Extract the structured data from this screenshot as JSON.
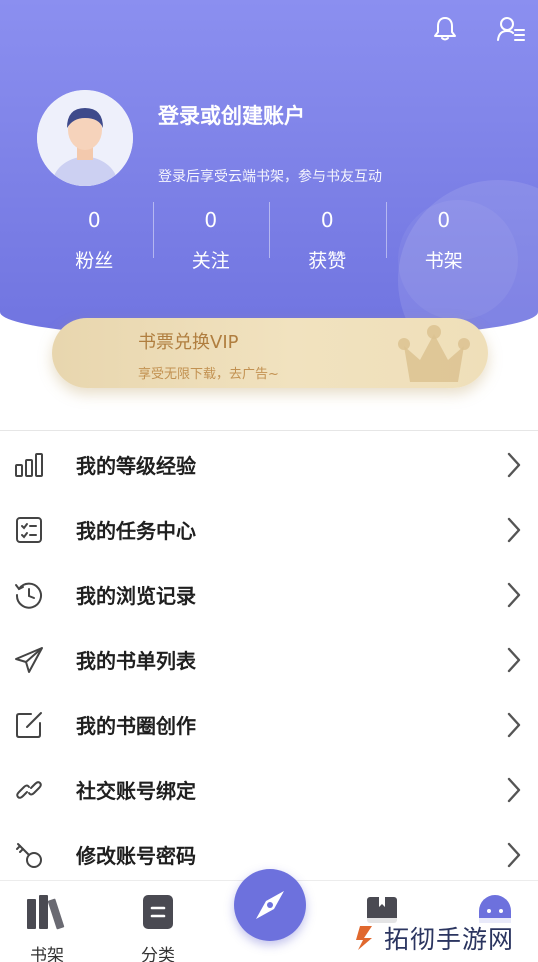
{
  "header": {
    "notification_icon": "bell-icon",
    "profile_settings_icon": "user-settings-icon",
    "avatar_icon": "default-avatar-icon",
    "login_title": "登录或创建账户",
    "login_subtitle": "登录后享受云端书架，参与书友互动",
    "stats": [
      {
        "value": "0",
        "label": "粉丝"
      },
      {
        "value": "0",
        "label": "关注"
      },
      {
        "value": "0",
        "label": "获赞"
      },
      {
        "value": "0",
        "label": "书架"
      }
    ]
  },
  "vip_card": {
    "title": "书票兑换VIP",
    "subtitle": "享受无限下载，去广告~",
    "icon": "crown-icon"
  },
  "menu": {
    "items": [
      {
        "label": "我的等级经验",
        "icon": "level-bars-icon"
      },
      {
        "label": "我的任务中心",
        "icon": "task-list-icon"
      },
      {
        "label": "我的浏览记录",
        "icon": "history-clock-icon"
      },
      {
        "label": "我的书单列表",
        "icon": "paper-plane-icon"
      },
      {
        "label": "我的书圈创作",
        "icon": "edit-square-icon"
      },
      {
        "label": "社交账号绑定",
        "icon": "link-icon"
      },
      {
        "label": "修改账号密码",
        "icon": "key-icon"
      }
    ],
    "arrow_icon": "chevron-right-icon"
  },
  "tabbar": {
    "tabs": [
      {
        "label": "书架",
        "icon": "bookshelf-icon"
      },
      {
        "label": "分类",
        "icon": "category-icon"
      },
      {
        "label": "",
        "icon": "compass-icon"
      },
      {
        "label": "",
        "icon": "bookmark-book-icon"
      },
      {
        "label": "",
        "icon": "profile-face-icon"
      }
    ]
  },
  "watermark": {
    "text": "拓彻手游网"
  },
  "colors": {
    "header_purple": "#7f83e8",
    "vip_gold": "#b07e3f",
    "accent_compass": "#6d71dd"
  }
}
